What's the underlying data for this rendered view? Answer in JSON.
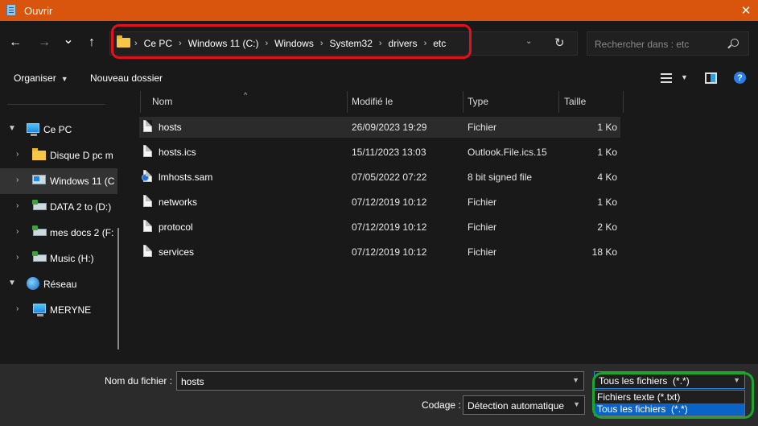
{
  "window": {
    "title": "Ouvrir",
    "close_glyph": "✕"
  },
  "nav": {
    "back_glyph": "←",
    "forward_glyph": "→",
    "recent_glyph": "⌄",
    "up_glyph": "↑"
  },
  "address": {
    "crumbs": [
      "Ce PC",
      "Windows 11 (C:)",
      "Windows",
      "System32",
      "drivers",
      "etc"
    ],
    "separator": "›",
    "dropdown_glyph": "⌄",
    "refresh_glyph": "↻",
    "highlight_color": "#e3101d"
  },
  "search": {
    "placeholder": "Rechercher dans : etc"
  },
  "toolbar": {
    "organize_label": "Organiser",
    "new_folder_label": "Nouveau dossier",
    "help_glyph": "?"
  },
  "sidebar": {
    "items": [
      {
        "label": "Ce PC",
        "icon": "pc-icon"
      },
      {
        "label": "Disque D pc m",
        "icon": "folder-icon"
      },
      {
        "label": "Windows 11 (C",
        "icon": "windows-drive-icon"
      },
      {
        "label": "DATA 2 to (D:)",
        "icon": "network-drive-icon"
      },
      {
        "label": "mes docs 2 (F:",
        "icon": "network-drive-icon"
      },
      {
        "label": "Music (H:)",
        "icon": "network-drive-icon"
      },
      {
        "label": "Réseau",
        "icon": "network-icon"
      },
      {
        "label": "MERYNE",
        "icon": "pc-icon"
      }
    ]
  },
  "columns": {
    "name": "Nom",
    "modified": "Modifié le",
    "type": "Type",
    "size": "Taille"
  },
  "files": [
    {
      "name": "hosts",
      "modified": "26/09/2023 19:29",
      "type": "Fichier",
      "size": "1 Ko",
      "icon": "file-icon"
    },
    {
      "name": "hosts.ics",
      "modified": "15/11/2023 13:03",
      "type": "Outlook.File.ics.15",
      "size": "1 Ko",
      "icon": "file-icon"
    },
    {
      "name": "lmhosts.sam",
      "modified": "07/05/2022 07:22",
      "type": "8 bit signed file",
      "size": "4 Ko",
      "icon": "system-file-icon"
    },
    {
      "name": "networks",
      "modified": "07/12/2019 10:12",
      "type": "Fichier",
      "size": "1 Ko",
      "icon": "file-icon"
    },
    {
      "name": "protocol",
      "modified": "07/12/2019 10:12",
      "type": "Fichier",
      "size": "2 Ko",
      "icon": "file-icon"
    },
    {
      "name": "services",
      "modified": "07/12/2019 10:12",
      "type": "Fichier",
      "size": "18 Ko",
      "icon": "file-icon"
    }
  ],
  "footer": {
    "filename_label": "Nom du fichier :",
    "filename_value": "hosts",
    "filter_value": "Tous les fichiers  (*.*)",
    "encoding_label": "Codage :",
    "encoding_value": "Détection automatique",
    "filter_options": [
      "Fichiers texte (*.txt)",
      "Tous les fichiers  (*.*)"
    ],
    "highlight_color": "#1ca62f"
  }
}
